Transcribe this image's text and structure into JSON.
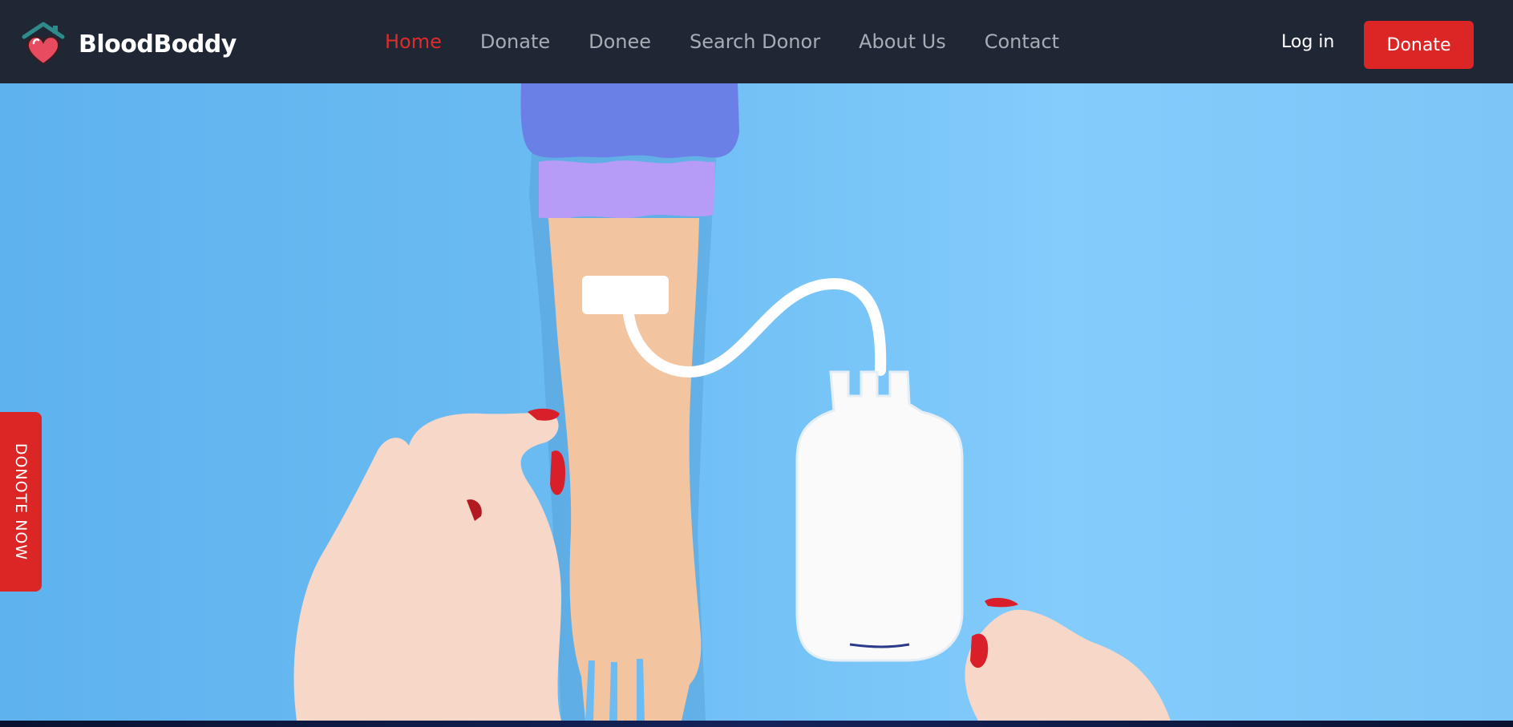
{
  "brand": {
    "name": "BloodBoddy",
    "logo_icon": "heart-house-icon"
  },
  "nav": {
    "items": [
      {
        "label": "Home",
        "active": true
      },
      {
        "label": "Donate",
        "active": false
      },
      {
        "label": "Donee",
        "active": false
      },
      {
        "label": "Search Donor",
        "active": false
      },
      {
        "label": "About Us",
        "active": false
      },
      {
        "label": "Contact",
        "active": false
      }
    ],
    "login_label": "Log in",
    "donate_label": "Donate"
  },
  "side_tab": {
    "label": "DONOTE NOW"
  },
  "colors": {
    "navbar_bg": "#1f2735",
    "accent": "#dc2626",
    "nav_text": "#a8adb5",
    "hero_bg": "#6cbcf3"
  }
}
